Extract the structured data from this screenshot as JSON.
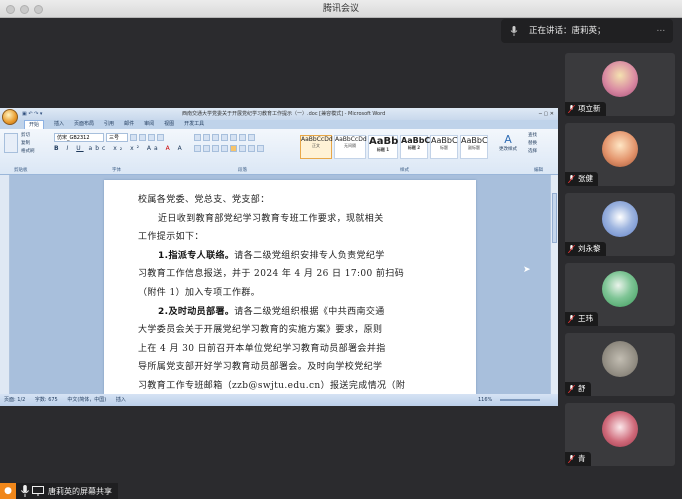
{
  "window": {
    "title": "腾讯会议"
  },
  "speaking": {
    "label": "正在讲话：唐莉英；"
  },
  "participants": [
    {
      "name": "项立新",
      "avatar_color": "#d98aa2"
    },
    {
      "name": "张健",
      "avatar_color": "#e3946c"
    },
    {
      "name": "刘永黎",
      "avatar_color": "#5f7fc8"
    },
    {
      "name": "王玮",
      "avatar_color": "#3a9a5a"
    },
    {
      "name": "舒",
      "avatar_color": "#8f8a80"
    },
    {
      "name": "青",
      "avatar_color": "#cf6a7a"
    }
  ],
  "share": {
    "label": "唐莉英的屏幕共享"
  },
  "word": {
    "title": "西南交通大学党委关于开展党纪学习教育工作提示（一）.doc [兼容模式] - Microsoft Word",
    "tabs": [
      "开始",
      "插入",
      "页面布局",
      "引用",
      "邮件",
      "审阅",
      "视图",
      "开发工具"
    ],
    "font_name": "仿宋_GB2312",
    "font_size": "三号",
    "clipboard_items": [
      "剪切",
      "复制",
      "格式刷"
    ],
    "clipboard_label": "剪贴板",
    "font_label": "字体",
    "paragraph_label": "段落",
    "styles_label": "样式",
    "editing_label": "编辑",
    "styles": [
      {
        "preview": "AaBbCcDd",
        "name": "正文"
      },
      {
        "preview": "AaBbCcDd",
        "name": "无间隔"
      },
      {
        "preview": "AaBb",
        "name": "标题 1"
      },
      {
        "preview": "AaBbC",
        "name": "标题 2"
      },
      {
        "preview": "AaBbC",
        "name": "标题"
      },
      {
        "preview": "AaBbC",
        "name": "副标题"
      }
    ],
    "change_styles": "更改样式",
    "edit_items": [
      "查找",
      "替换",
      "选择"
    ],
    "doc_lines": {
      "l1": "校属各党委、党总支、党支部：",
      "l2": "近日收到教育部党纪学习教育专班工作要求，现就相关",
      "l3": "工作提示如下：",
      "l4a": "1.指派专人联络。",
      "l4b": "请各二级党组织安排专人负责党纪学",
      "l5": "习教育工作信息报送，并于 2024 年 4 月 26 日 17:00 前扫码",
      "l6": "（附件 1）加入专项工作群。",
      "l7a": "2.及时动员部署。",
      "l7b": "请各二级党组织根据《中共西南交通",
      "l8": "大学委员会关于开展党纪学习教育的实施方案》要求，原则",
      "l9": "上在 4 月 30 日前召开本单位党纪学习教育动员部署会并指",
      "l10": "导所属党支部开好学习教育动员部署会。及时向学校党纪学",
      "l11": "习教育工作专班邮箱（zzb@swjtu.edu.cn）报送完成情况（附"
    },
    "status": {
      "page": "页面: 1/2",
      "words": "字数: 675",
      "lang": "中文(简体，中国)",
      "mode": "插入",
      "zoom": "116%"
    }
  }
}
